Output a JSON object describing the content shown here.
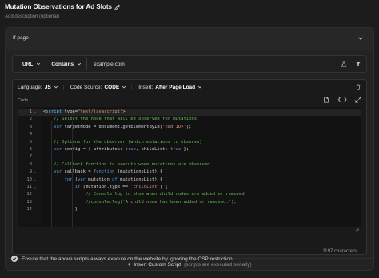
{
  "header": {
    "title": "Mutation Observations for Ad Slots",
    "description": "Add description (optional)"
  },
  "if_page": {
    "label": "If page"
  },
  "filter": {
    "field": "URL",
    "operator": "Contains",
    "value": "example.com"
  },
  "toolbar": {
    "language_label": "Language:",
    "language_value": "JS",
    "source_label": "Code Source:",
    "source_value": "CODE",
    "insert_label": "Insert:",
    "insert_value": "After Page Load"
  },
  "code": {
    "label": "Code",
    "lines": [
      {
        "n": "1",
        "fold": "⌄",
        "text": "<script type=\"text/javascript\">"
      },
      {
        "n": "2",
        "fold": "",
        "text": "    // Select the node that will be observed for mutations"
      },
      {
        "n": "3",
        "fold": "",
        "text": "    var targetNode = document.getElementById('<ad_ID>');"
      },
      {
        "n": "4",
        "fold": "",
        "text": ""
      },
      {
        "n": "5",
        "fold": "",
        "text": "    // Options for the observer (which mutations to observe)"
      },
      {
        "n": "6",
        "fold": "",
        "text": "    var config = { attributes: true, childList: true };"
      },
      {
        "n": "7",
        "fold": "",
        "text": ""
      },
      {
        "n": "8",
        "fold": "",
        "text": "    // Callback function to execute when mutations are observed"
      },
      {
        "n": "9",
        "fold": "⌄",
        "text": "    var callback = function (mutationsList) {"
      },
      {
        "n": "10",
        "fold": "⌄",
        "text": "        for (var mutation of mutationsList) {"
      },
      {
        "n": "11",
        "fold": "⌄",
        "text": "            if (mutation.type == 'childList') {"
      },
      {
        "n": "12",
        "fold": "",
        "text": "                // Console log to show when child nodes are added or removed"
      },
      {
        "n": "13",
        "fold": "",
        "text": "                //console.log('A child node has been added or removed.');"
      },
      {
        "n": "14",
        "fold": "",
        "text": "            }"
      }
    ],
    "char_count": "1197 characters"
  },
  "insert_script": {
    "plus": "+",
    "label": "Insert Custom Script",
    "note": "(scripts are executed serially)"
  },
  "csp": {
    "label": "Ensure that the above scripts always execute on the website by ignoring the CSP restriction",
    "checked": true
  },
  "colors": {
    "comment": "#6bbf59",
    "keyword": "#569cd6",
    "string": "#ce9178",
    "text": "#d4d4d4",
    "tag": "#4fc1ff"
  },
  "icons": [
    "pencil-icon",
    "chevron-down-icon",
    "flask-icon",
    "filter-icon",
    "trash-icon",
    "file-icon",
    "code-braces-icon",
    "expand-icon",
    "check-icon"
  ]
}
